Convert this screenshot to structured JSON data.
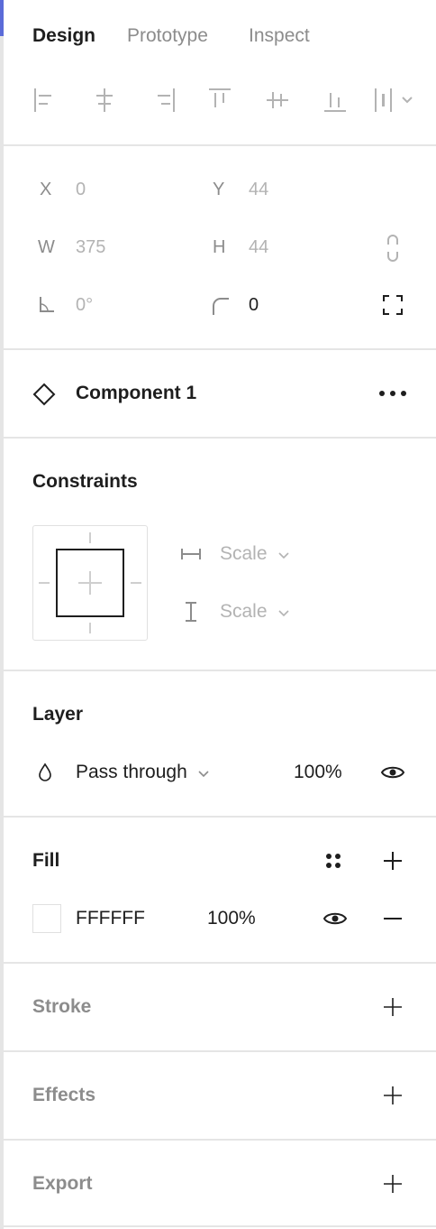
{
  "tabs": [
    {
      "label": "Design"
    },
    {
      "label": "Prototype"
    },
    {
      "label": "Inspect"
    }
  ],
  "align_tools": [
    "align-left-icon",
    "align-horizontal-center-icon",
    "align-right-icon",
    "align-top-icon",
    "align-vertical-center-icon",
    "align-bottom-icon",
    "distribute-icon"
  ],
  "geometry": {
    "x_label": "X",
    "x_value": "0",
    "y_label": "Y",
    "y_value": "44",
    "w_label": "W",
    "w_value": "375",
    "h_label": "H",
    "h_value": "44",
    "rotation_value": "0°",
    "radius_value": "0"
  },
  "component": {
    "name": "Component 1"
  },
  "constraints": {
    "title": "Constraints",
    "horizontal": "Scale",
    "vertical": "Scale"
  },
  "layer": {
    "title": "Layer",
    "blend_mode": "Pass through",
    "opacity": "100%"
  },
  "fill": {
    "title": "Fill",
    "color_hex": "FFFFFF",
    "opacity": "100%",
    "swatch_color": "#FFFFFF"
  },
  "stroke": {
    "title": "Stroke"
  },
  "effects": {
    "title": "Effects"
  },
  "export": {
    "title": "Export"
  },
  "colors": {
    "text": "#1e1e1e",
    "muted": "#8c8c8c",
    "faint": "#b3b3b3",
    "divider": "#e5e5e5",
    "accent": "#5b6bd8"
  }
}
